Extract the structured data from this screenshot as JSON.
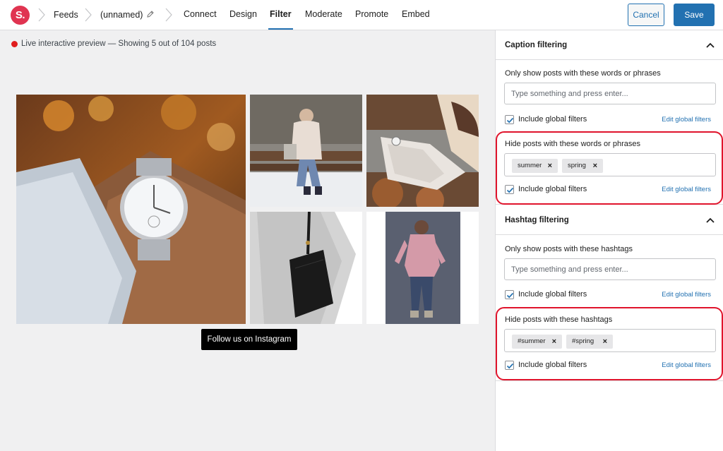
{
  "topbar": {
    "logo_text": "S.",
    "breadcrumb": [
      "Feeds",
      "(unnamed)"
    ],
    "tabs": [
      {
        "label": "Connect",
        "active": false
      },
      {
        "label": "Design",
        "active": false
      },
      {
        "label": "Filter",
        "active": true
      },
      {
        "label": "Moderate",
        "active": false
      },
      {
        "label": "Promote",
        "active": false
      },
      {
        "label": "Embed",
        "active": false
      }
    ],
    "cancel_label": "Cancel",
    "save_label": "Save"
  },
  "preview": {
    "status_text": "Live interactive preview — Showing 5 out of 104 posts",
    "follow_label": "Follow us on Instagram",
    "photos": [
      "watch-photo",
      "bench-photo",
      "sweater-photo",
      "bag-photo",
      "pink-top-photo"
    ]
  },
  "sidebar": {
    "caption": {
      "title": "Caption filtering",
      "show_label": "Only show posts with these words or phrases",
      "show_placeholder": "Type something and press enter...",
      "show_global_label": "Include global filters",
      "show_edit_link": "Edit global filters",
      "hide_label": "Hide posts with these words or phrases",
      "hide_tags": [
        "summer",
        "spring"
      ],
      "hide_global_label": "Include global filters",
      "hide_edit_link": "Edit global filters"
    },
    "hashtag": {
      "title": "Hashtag filtering",
      "show_label": "Only show posts with these hashtags",
      "show_placeholder": "Type something and press enter...",
      "show_global_label": "Include global filters",
      "show_edit_link": "Edit global filters",
      "hide_label": "Hide posts with these hashtags",
      "hide_tags": [
        "#summer",
        "#spring"
      ],
      "hide_global_label": "Include global filters",
      "hide_edit_link": "Edit global filters"
    },
    "tag_remove_glyph": "×"
  },
  "colors": {
    "brand": "#e03451",
    "accent": "#2271b1",
    "highlight": "#e0142c"
  }
}
